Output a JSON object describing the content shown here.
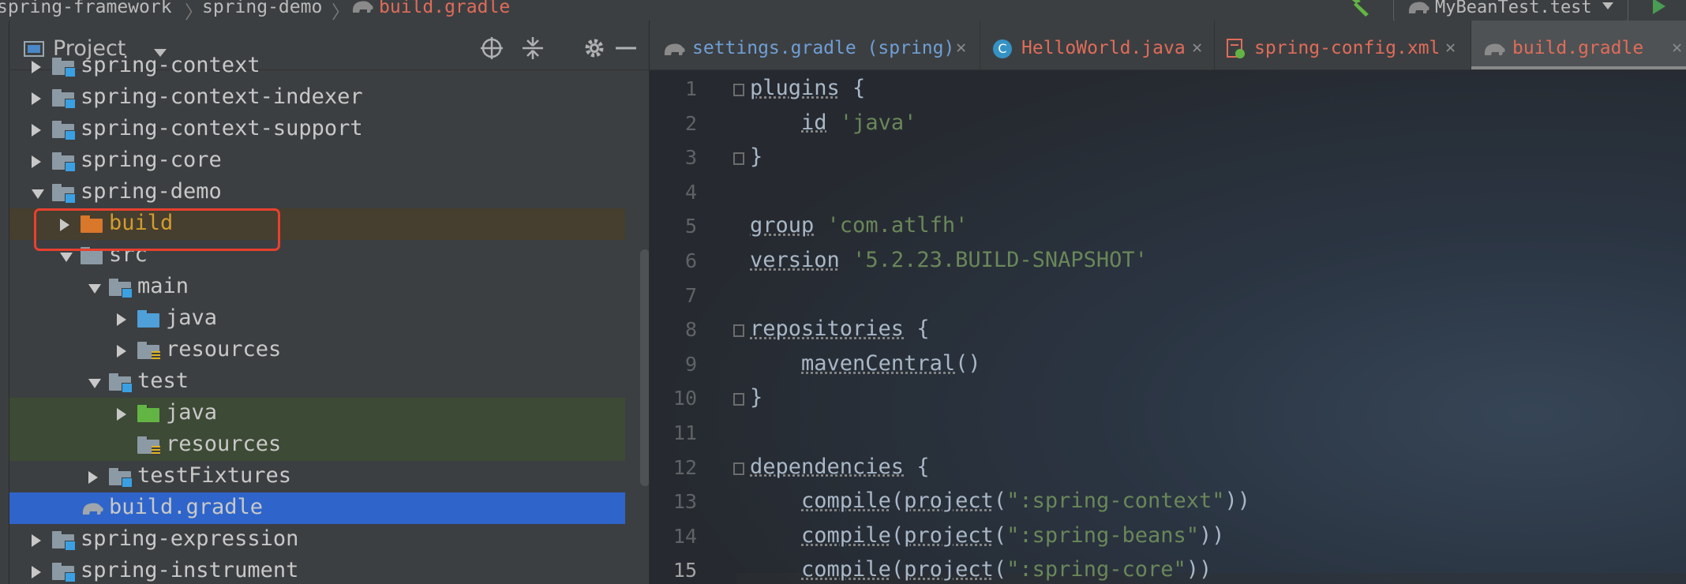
{
  "breadcrumb": {
    "items": [
      "spring-framework",
      "spring-demo",
      "build.gradle"
    ]
  },
  "toolbar": {
    "run_config": "MyBeanTest.test"
  },
  "project_panel": {
    "title": "Project",
    "tree": [
      {
        "label": "spring-context",
        "depth": 0,
        "state": "collapsed",
        "icon": "module-folder-icon"
      },
      {
        "label": "spring-context-indexer",
        "depth": 0,
        "state": "collapsed",
        "icon": "module-folder-icon"
      },
      {
        "label": "spring-context-support",
        "depth": 0,
        "state": "collapsed",
        "icon": "module-folder-icon"
      },
      {
        "label": "spring-core",
        "depth": 0,
        "state": "collapsed",
        "icon": "module-folder-icon"
      },
      {
        "label": "spring-demo",
        "depth": 0,
        "state": "expanded",
        "icon": "module-folder-icon",
        "highlighted": true
      },
      {
        "label": "build",
        "depth": 1,
        "state": "collapsed",
        "icon": "excluded-folder-icon"
      },
      {
        "label": "src",
        "depth": 1,
        "state": "expanded",
        "icon": "folder-icon"
      },
      {
        "label": "main",
        "depth": 2,
        "state": "expanded",
        "icon": "module-folder-icon"
      },
      {
        "label": "java",
        "depth": 3,
        "state": "collapsed",
        "icon": "source-folder-icon"
      },
      {
        "label": "resources",
        "depth": 3,
        "state": "collapsed",
        "icon": "resources-folder-icon"
      },
      {
        "label": "test",
        "depth": 2,
        "state": "expanded",
        "icon": "module-folder-icon"
      },
      {
        "label": "java",
        "depth": 3,
        "state": "collapsed",
        "icon": "test-source-folder-icon"
      },
      {
        "label": "resources",
        "depth": 3,
        "state": "leaf",
        "icon": "test-resources-folder-icon"
      },
      {
        "label": "testFixtures",
        "depth": 2,
        "state": "collapsed",
        "icon": "module-folder-icon"
      },
      {
        "label": "build.gradle",
        "depth": 1,
        "state": "leaf",
        "icon": "gradle-file-icon",
        "selected": true
      },
      {
        "label": "spring-expression",
        "depth": 0,
        "state": "collapsed",
        "icon": "module-folder-icon"
      },
      {
        "label": "spring-instrument",
        "depth": 0,
        "state": "collapsed",
        "icon": "module-folder-icon"
      }
    ]
  },
  "editor": {
    "tabs": [
      {
        "label": "settings.gradle (spring)",
        "icon": "gradle-icon",
        "active": false
      },
      {
        "label": "HelloWorld.java",
        "icon": "java-class-icon",
        "active": false
      },
      {
        "label": "spring-config.xml",
        "icon": "xml-spring-icon",
        "active": false
      },
      {
        "label": "build.gradle",
        "icon": "gradle-icon",
        "active": true
      }
    ],
    "current_line": 15,
    "lines": [
      {
        "n": "1",
        "text": "plugins {"
      },
      {
        "n": "2",
        "text": "    id 'java'"
      },
      {
        "n": "3",
        "text": "}"
      },
      {
        "n": "4",
        "text": ""
      },
      {
        "n": "5",
        "text": "group 'com.atlfh'"
      },
      {
        "n": "6",
        "text": "version '5.2.23.BUILD-SNAPSHOT'"
      },
      {
        "n": "7",
        "text": ""
      },
      {
        "n": "8",
        "text": "repositories {"
      },
      {
        "n": "9",
        "text": "    mavenCentral()"
      },
      {
        "n": "10",
        "text": "}"
      },
      {
        "n": "11",
        "text": ""
      },
      {
        "n": "12",
        "text": "dependencies {"
      },
      {
        "n": "13",
        "text": "    compile(project(\":spring-context\"))"
      },
      {
        "n": "14",
        "text": "    compile(project(\":spring-beans\"))"
      },
      {
        "n": "15",
        "text": "    compile(project(\":spring-core\"))"
      }
    ]
  },
  "colors": {
    "selection": "#2f65ca",
    "highlight_box": "#e8402f",
    "string": "#6a8759",
    "breadcrumb_active": "#e06c5a"
  }
}
